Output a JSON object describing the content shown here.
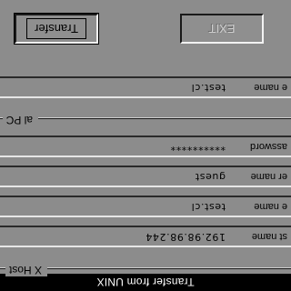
{
  "window": {
    "title": "Transfer from UNIX"
  },
  "unix_host": {
    "label": "X Host",
    "fields": [
      {
        "label": "st name",
        "value": "192.98.98.244"
      },
      {
        "label": "e name",
        "value": "test.cl"
      },
      {
        "label": "er name",
        "value": "guest"
      },
      {
        "label": "assword",
        "value": "**********"
      }
    ]
  },
  "local_pc": {
    "label": "al PC",
    "fields": [
      {
        "label": "e name",
        "value": "test.cl"
      }
    ]
  },
  "buttons": {
    "transfer": "Transfer",
    "exit": "EXIT"
  }
}
